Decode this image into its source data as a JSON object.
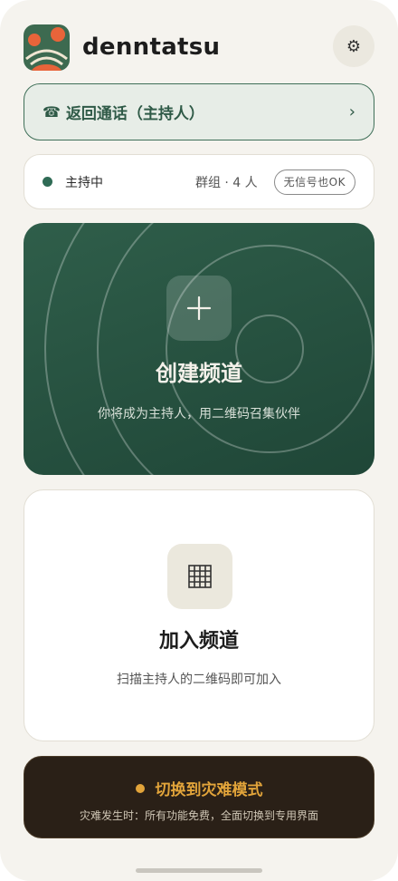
{
  "app": {
    "title": "denntatsu",
    "icon": "app-logo-icon",
    "settings_icon": "gear-icon"
  },
  "return_call": {
    "icon": "phone-icon",
    "label": "返回通话（主持人）",
    "chevron": "›"
  },
  "status": {
    "state": "主持中",
    "group": "群组 · 4 人",
    "badge": "无信号也OK",
    "dot_color": "#2f6b55"
  },
  "create_channel": {
    "icon": "plus-icon",
    "title": "创建频道",
    "subtitle": "你将成为主持人，用二维码召集伙伴"
  },
  "join_channel": {
    "icon": "qr-grid-icon",
    "title": "加入频道",
    "subtitle": "扫描主持人的二维码即可加入"
  },
  "disaster_mode": {
    "title": "切换到灾难模式",
    "subtitle": "灾难发生时：所有功能免费，全面切换到专用界面",
    "accent": "#e2a43a"
  },
  "colors": {
    "primary": "#2f5e4a",
    "background": "#f5f3ee",
    "disaster_bg": "#2a2017"
  }
}
